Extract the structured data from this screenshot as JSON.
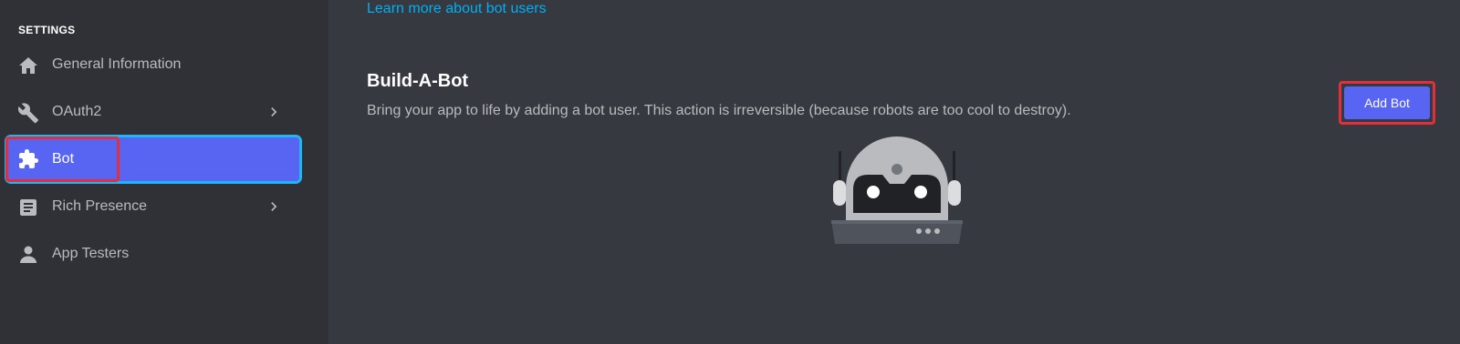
{
  "sidebar": {
    "section_title": "SETTINGS",
    "items": [
      {
        "label": "General Information",
        "icon": "home-icon",
        "has_chevron": false,
        "selected": false
      },
      {
        "label": "OAuth2",
        "icon": "wrench-icon",
        "has_chevron": true,
        "selected": false
      },
      {
        "label": "Bot",
        "icon": "puzzle-icon",
        "has_chevron": false,
        "selected": true
      },
      {
        "label": "Rich Presence",
        "icon": "document-icon",
        "has_chevron": true,
        "selected": false
      },
      {
        "label": "App Testers",
        "icon": "user-icon",
        "has_chevron": false,
        "selected": false
      }
    ]
  },
  "main": {
    "learn_more_link": "Learn more about bot users",
    "build_a_bot": {
      "title": "Build-A-Bot",
      "description": "Bring your app to life by adding a bot user. This action is irreversible (because robots are too cool to destroy).",
      "add_bot_label": "Add Bot"
    }
  },
  "colors": {
    "background": "#36393f",
    "sidebar": "#2f3136",
    "accent": "#5865f2",
    "link": "#00aff4",
    "highlight_box": "#e0303b",
    "focus_outline": "#1fb6f3"
  }
}
